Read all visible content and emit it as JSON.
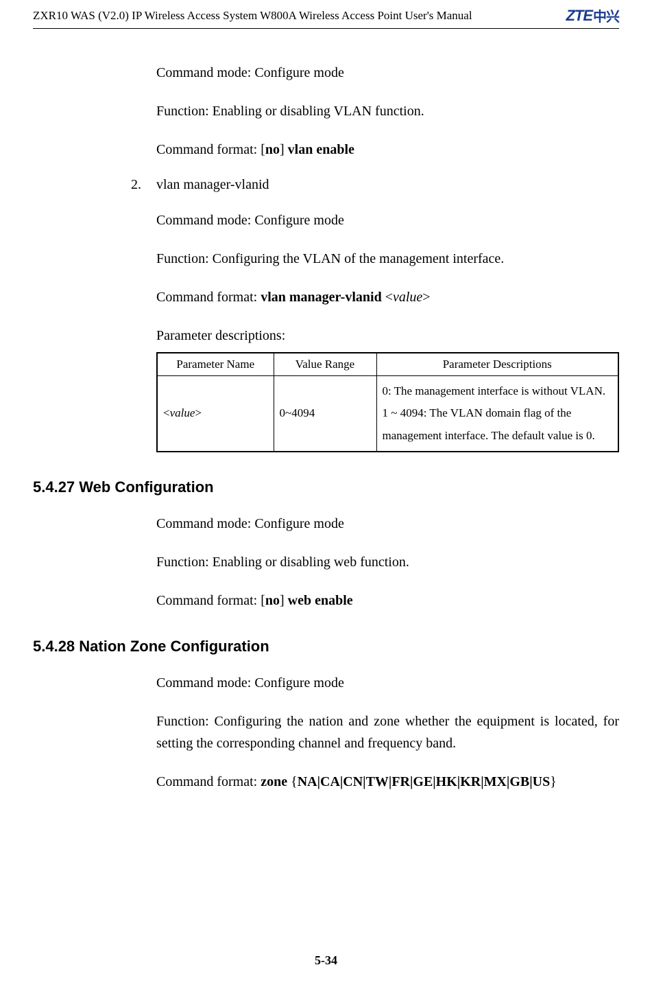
{
  "header": {
    "title": "ZXR10 WAS (V2.0) IP Wireless Access System W800A Wireless Access Point User's Manual",
    "logo_text": "ZTE",
    "logo_cn": "中兴"
  },
  "body": {
    "p1": "Command mode: Configure mode",
    "p2": "Function: Enabling or disabling VLAN function.",
    "p3_prefix": "Command format: [",
    "p3_no": "no",
    "p3_mid": "] ",
    "p3_bold": "vlan enable",
    "item2_num": "2.",
    "item2_text": "vlan manager-vlanid",
    "p4": "Command mode: Configure mode",
    "p5": "Function: Configuring the VLAN of the management interface.",
    "p6_prefix": "Command format: ",
    "p6_bold": "vlan manager-vlanid",
    "p6_open": " <",
    "p6_val": "value",
    "p6_close": ">",
    "p7": "Parameter descriptions:"
  },
  "table": {
    "h1": "Parameter Name",
    "h2": "Value Range",
    "h3": "Parameter Descriptions",
    "r1c1_open": "<",
    "r1c1_val": "value",
    "r1c1_close": ">",
    "r1c2": "0~4094",
    "r1c3": "0: The management interface is without VLAN. 1 ~ 4094: The VLAN domain flag of the management interface. The default value is 0."
  },
  "s27": {
    "heading": "5.4.27 Web Configuration",
    "p1": "Command mode: Configure mode",
    "p2": "Function: Enabling or disabling web function.",
    "p3_prefix": "Command format: [",
    "p3_no": "no",
    "p3_mid": "] ",
    "p3_bold": "web enable"
  },
  "s28": {
    "heading": "5.4.28 Nation Zone Configuration",
    "p1": "Command mode: Configure mode",
    "p2": "Function: Configuring the nation and zone whether the equipment is located, for setting the corresponding channel and frequency band.",
    "p3_prefix": "Command format: ",
    "p3_bold1": "zone",
    "p3_space": " {",
    "p3_bold2": "NA|CA|CN|TW|FR|GE|HK|KR|MX|GB|US",
    "p3_close": "}"
  },
  "footer": {
    "page": "5-34"
  }
}
